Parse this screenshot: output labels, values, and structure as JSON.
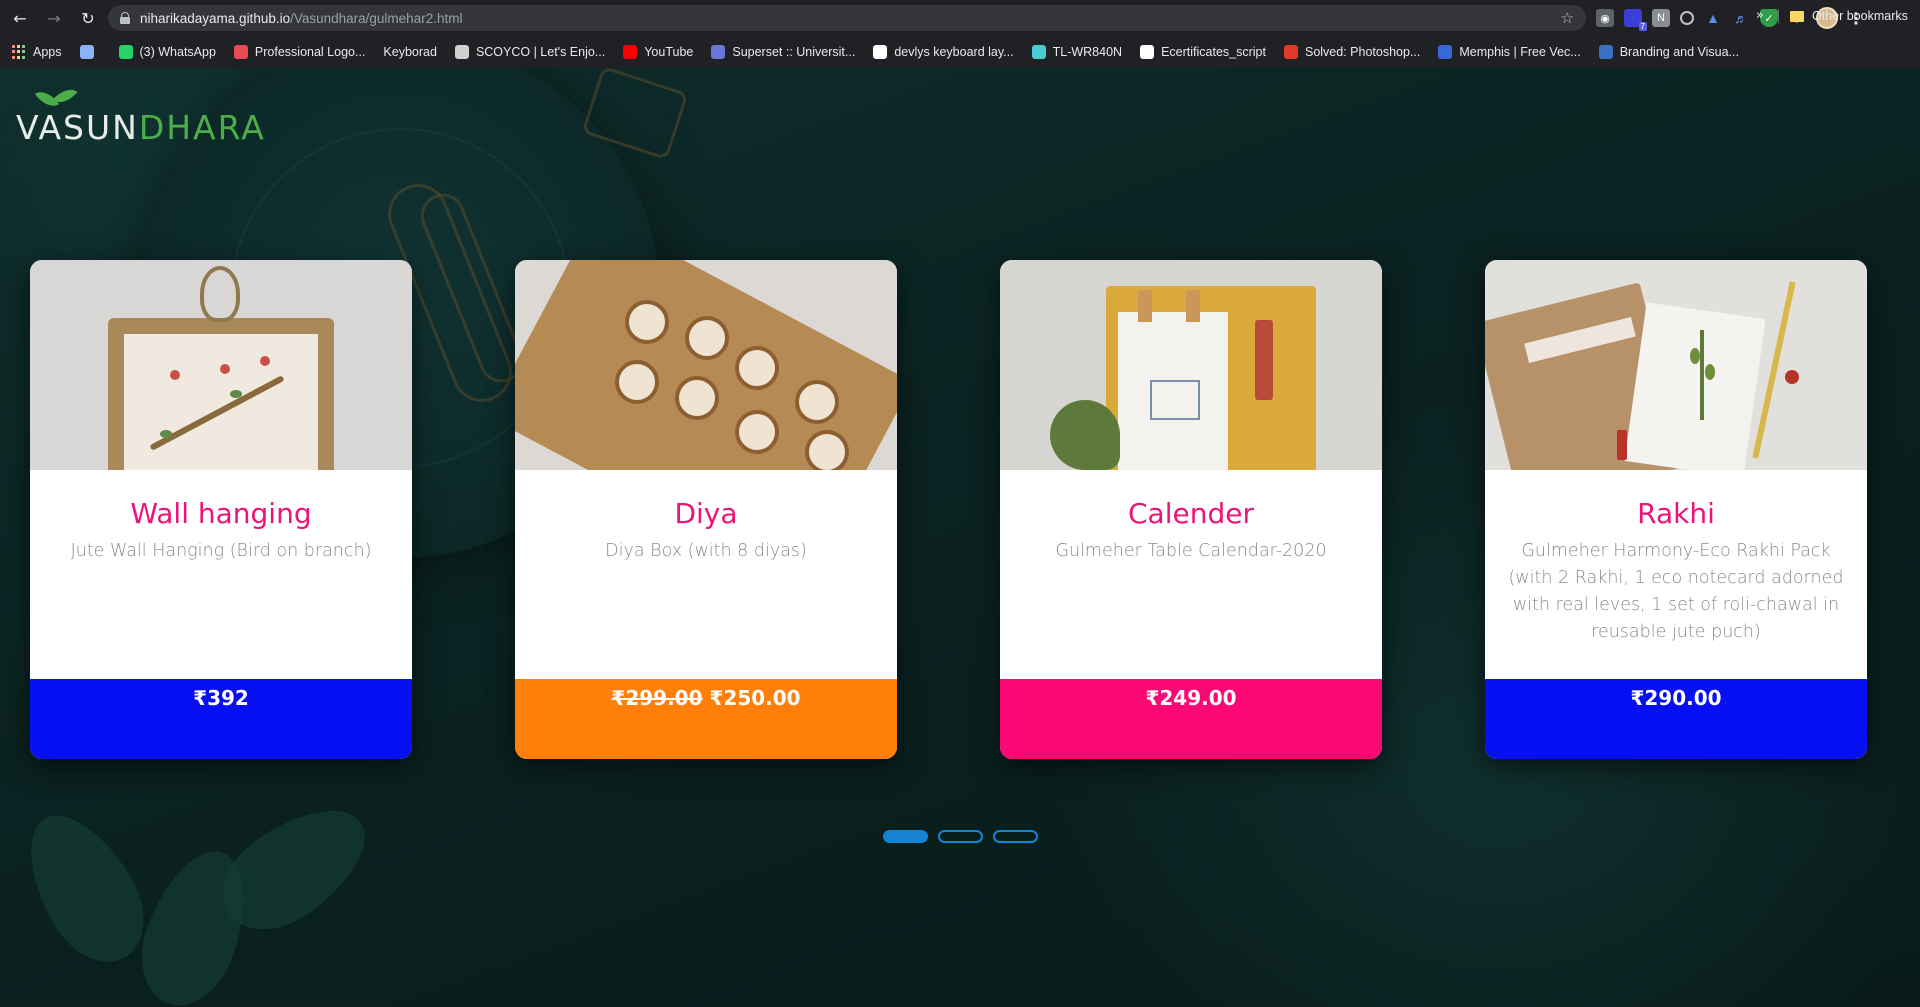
{
  "browser": {
    "url_host": "niharikadayama.github.io",
    "url_path": "/Vasundhara/gulmehar2.html",
    "bookmarks": [
      {
        "label": "Apps",
        "icon": "apps-grid-icon"
      },
      {
        "label": "",
        "icon": "mail-icon",
        "color": "#8ab4f8"
      },
      {
        "label": "(3) WhatsApp",
        "icon": "whatsapp-icon",
        "color": "#25d366"
      },
      {
        "label": "Professional Logo...",
        "icon": "logo-maker-icon",
        "color": "#e94b55"
      },
      {
        "label": "Keyborad",
        "icon": "",
        "color": ""
      },
      {
        "label": "SCOYCO | Let's Enjo...",
        "icon": "scoyco-icon",
        "color": "#d0d0d0"
      },
      {
        "label": "YouTube",
        "icon": "youtube-icon",
        "color": "#ff0000"
      },
      {
        "label": "Superset :: Universit...",
        "icon": "superset-icon",
        "color": "#6a77d6"
      },
      {
        "label": "devlys keyboard lay...",
        "icon": "google-icon",
        "color": "#ffffff"
      },
      {
        "label": "TL-WR840N",
        "icon": "tplink-icon",
        "color": "#4acbd6"
      },
      {
        "label": "Ecertificates_script",
        "icon": "ecert-icon",
        "color": "#ffffff"
      },
      {
        "label": "Solved: Photoshop...",
        "icon": "adobe-icon",
        "color": "#e03a2f"
      },
      {
        "label": "Memphis | Free Vec...",
        "icon": "freepik-icon",
        "color": "#3867d6"
      },
      {
        "label": "Branding and Visua...",
        "icon": "ieee-icon",
        "color": "#3a6fc4"
      }
    ],
    "other_bookmarks": "Other bookmarks",
    "overflow": "»"
  },
  "site": {
    "logo_part1": "VASUN",
    "logo_part2": "DHARA"
  },
  "products": [
    {
      "title": "Wall hanging",
      "description": "Jute Wall Hanging (Bird on branch)",
      "price": "₹392",
      "old_price": "",
      "price_bar_color": "#0710f3"
    },
    {
      "title": "Diya",
      "description": "Diya Box (with 8 diyas)",
      "price": "₹250.00",
      "old_price": "₹299.00",
      "price_bar_color": "#ff7f08"
    },
    {
      "title": "Calender",
      "description": "Gulmeher Table Calendar-2020",
      "price": "₹249.00",
      "old_price": "",
      "price_bar_color": "#fc0874"
    },
    {
      "title": "Rakhi",
      "description": "Gulmeher Harmony-Eco Rakhi Pack (with 2 Rakhi, 1 eco notecard adorned with real leves, 1 set of roli-chawal in reusable jute puch)",
      "price": "₹290.00",
      "old_price": "",
      "price_bar_color": "#0710f3"
    }
  ],
  "pagination": {
    "pages": 3,
    "active": 1
  },
  "colors": {
    "accent": "#ec1479",
    "dot": "#1582d4",
    "logo_green": "#4cae4a"
  }
}
